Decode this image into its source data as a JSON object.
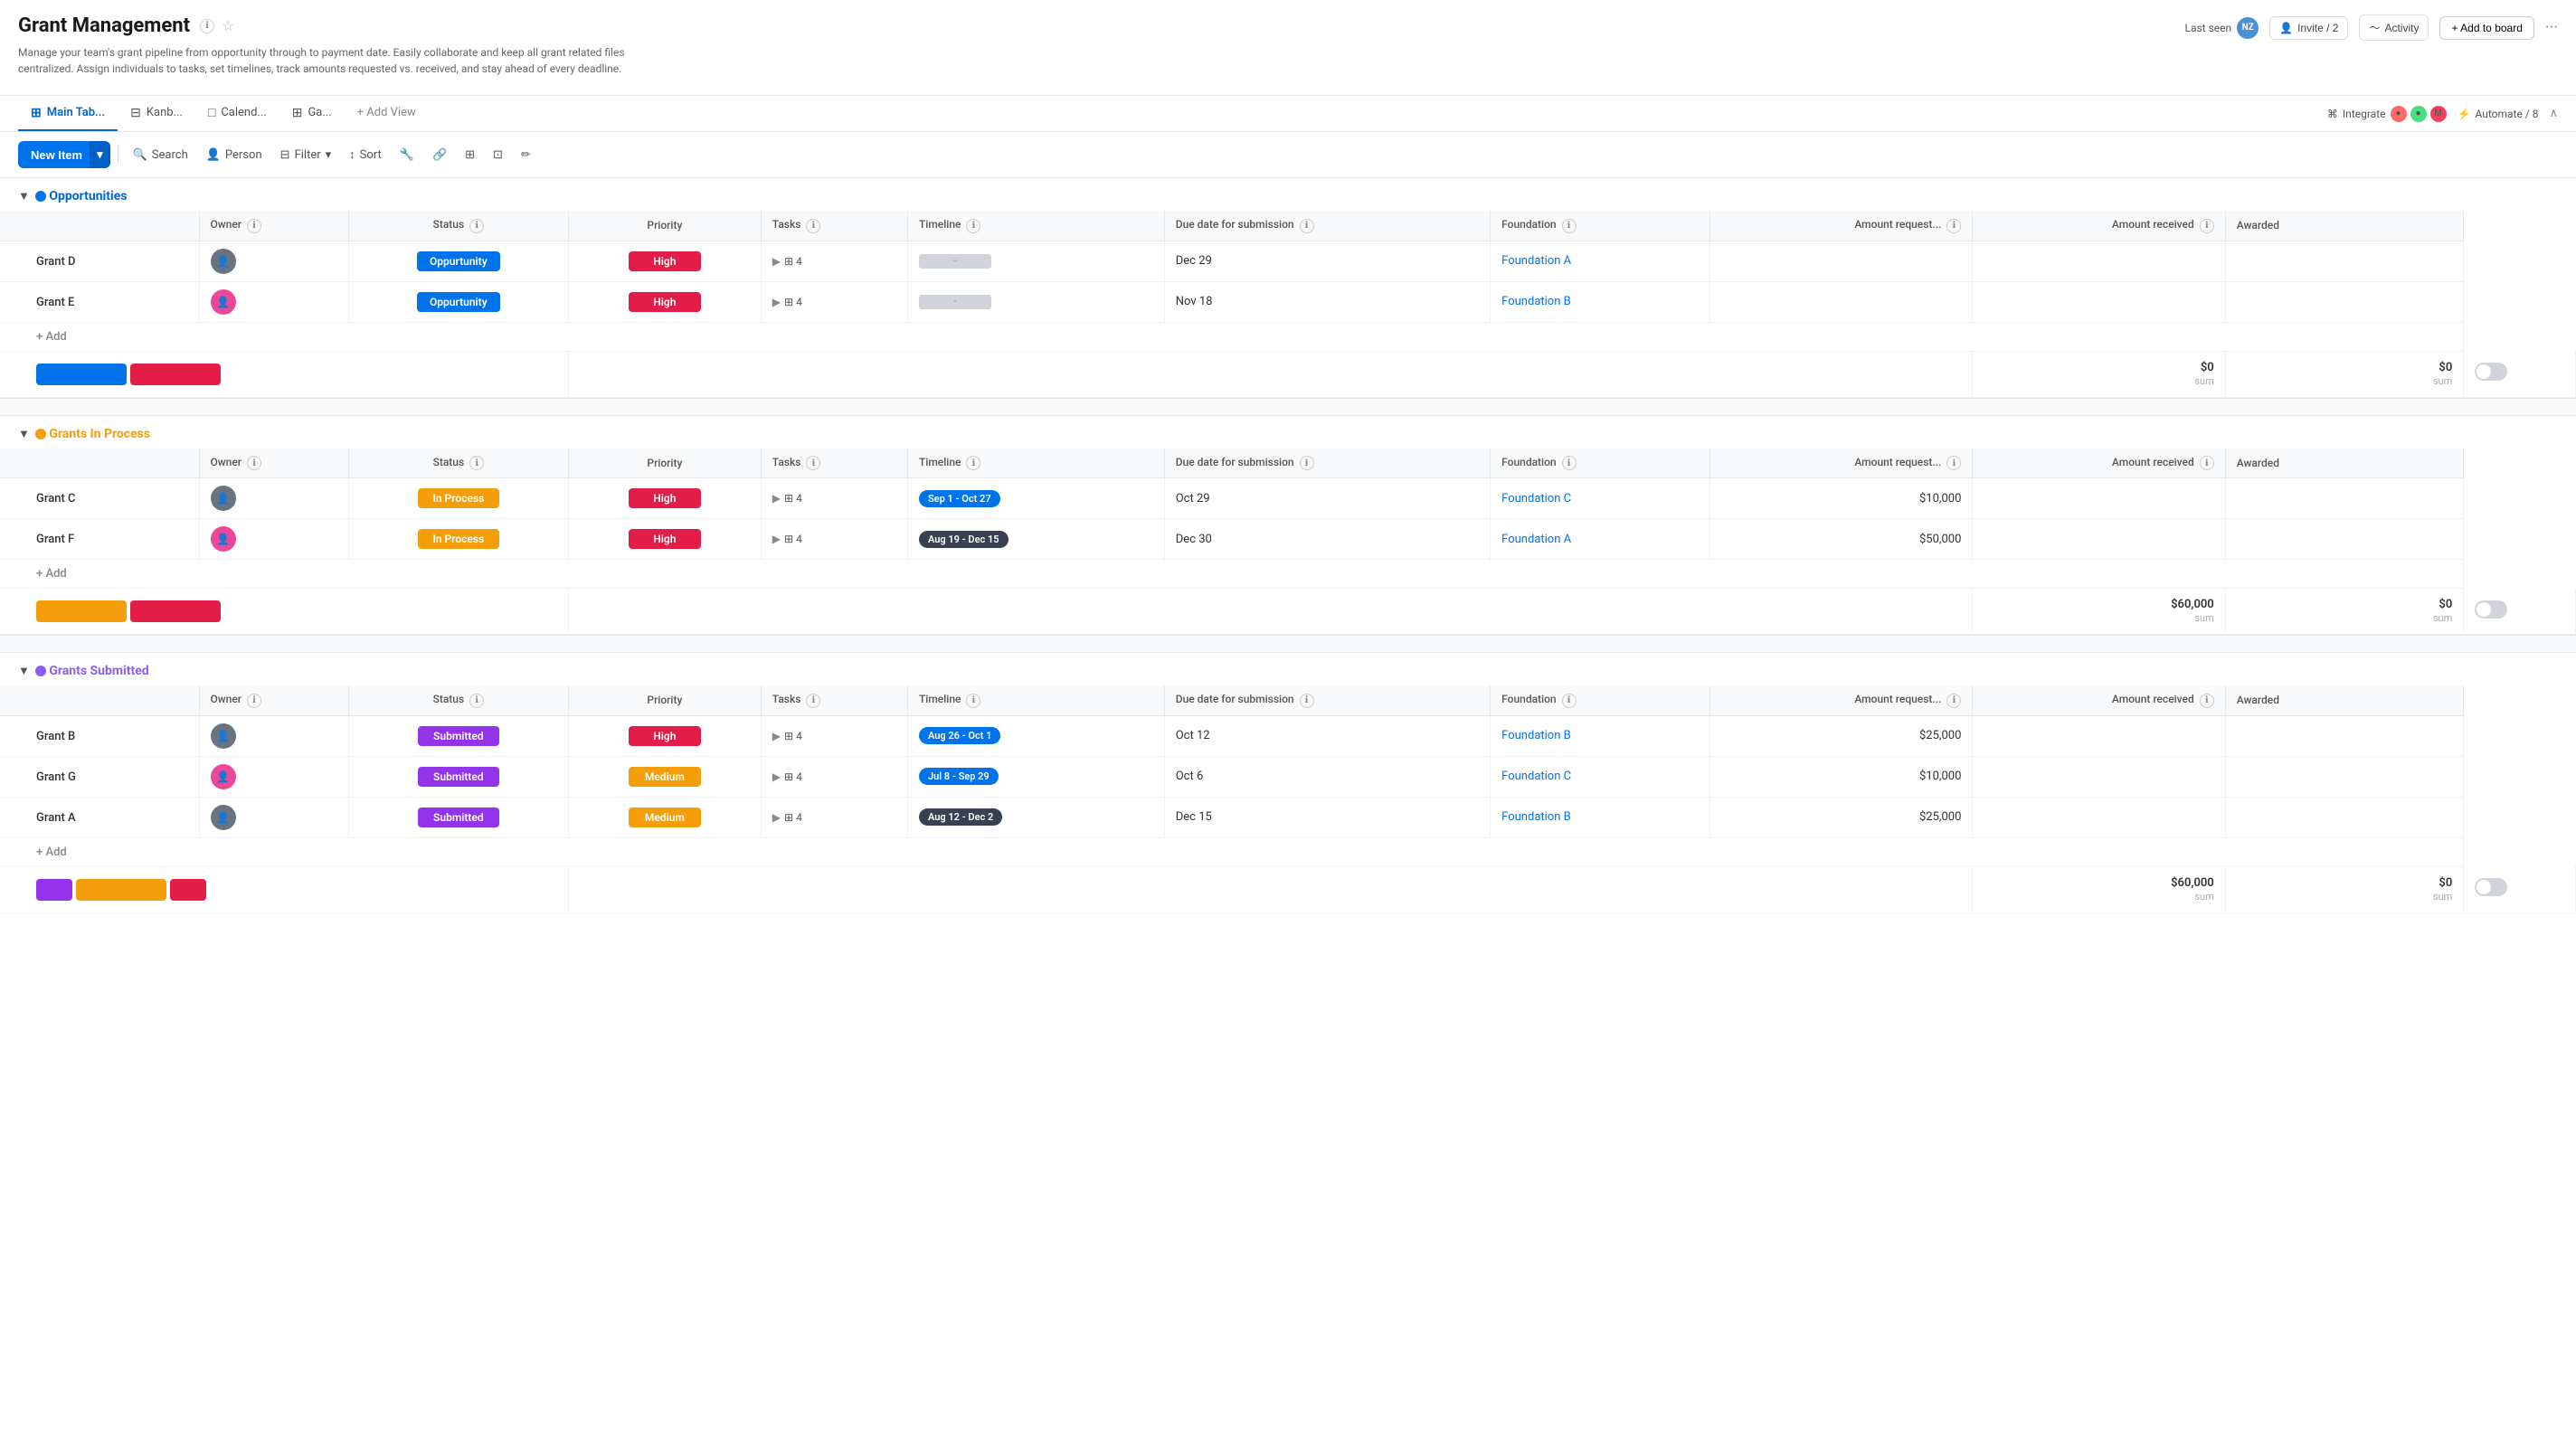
{
  "page": {
    "title": "Grant Management",
    "subtitle": "Manage your team's grant pipeline from opportunity through to payment date. Easily collaborate and keep all grant related files centralized. Assign individuals to tasks, set timelines, track amounts requested vs. received, and stay ahead of every deadline."
  },
  "header": {
    "last_seen_label": "Last seen",
    "invite_label": "Invite / 2",
    "activity_label": "Activity",
    "add_board_label": "+ Add to board",
    "avatar_initials": "NZ"
  },
  "tabs": [
    {
      "id": "main",
      "label": "Main Tab...",
      "icon": "⊞",
      "active": true
    },
    {
      "id": "kanban",
      "label": "Kanb...",
      "icon": "⊟",
      "active": false
    },
    {
      "id": "calendar",
      "label": "Calend...",
      "icon": "□",
      "active": false
    },
    {
      "id": "gantt",
      "label": "Ga...",
      "icon": "⊞",
      "active": false
    },
    {
      "id": "add",
      "label": "+ Add View",
      "icon": "",
      "active": false
    }
  ],
  "toolbar": {
    "new_item_label": "New Item",
    "search_label": "Search",
    "person_label": "Person",
    "filter_label": "Filter",
    "sort_label": "Sort",
    "integrate_label": "Integrate",
    "automate_label": "Automate / 8"
  },
  "sections": [
    {
      "id": "opportunities",
      "title": "Opportunities",
      "color": "blue",
      "columns": [
        "Owner",
        "Status",
        "Priority",
        "Tasks",
        "Timeline",
        "Due date for submission",
        "Foundation",
        "Amount request...",
        "Amount received",
        "Awarded"
      ],
      "rows": [
        {
          "name": "Grant D",
          "owner_gender": "male",
          "status": "Oppurtunity",
          "status_class": "badge-opportunity",
          "priority": "High",
          "priority_class": "priority-high",
          "tasks_count": "4",
          "timeline": "bar",
          "due_date": "Dec 29",
          "foundation": "Foundation A",
          "amount_req": "",
          "amount_rec": "",
          "awarded": ""
        },
        {
          "name": "Grant E",
          "owner_gender": "female",
          "status": "Oppurtunity",
          "status_class": "badge-opportunity",
          "priority": "High",
          "priority_class": "priority-high",
          "tasks_count": "4",
          "timeline": "bar",
          "due_date": "Nov 18",
          "foundation": "Foundation B",
          "amount_req": "",
          "amount_rec": "",
          "awarded": ""
        }
      ],
      "sum_amount_req": "$0",
      "sum_amount_rec": "$0",
      "bar_colors": [
        "blue",
        "red"
      ]
    },
    {
      "id": "grants-in-process",
      "title": "Grants In Process",
      "color": "orange",
      "columns": [
        "Owner",
        "Status",
        "Priority",
        "Tasks",
        "Timeline",
        "Due date for submission",
        "Foundation",
        "Amount request...",
        "Amount received",
        "Awarded"
      ],
      "rows": [
        {
          "name": "Grant C",
          "owner_gender": "male",
          "status": "In Process",
          "status_class": "badge-in-process",
          "priority": "High",
          "priority_class": "priority-high",
          "tasks_count": "4",
          "timeline": "Sep 1 - Oct 27",
          "timeline_class": "timeline-blue",
          "due_date": "Oct 29",
          "foundation": "Foundation C",
          "amount_req": "$10,000",
          "amount_rec": "",
          "awarded": ""
        },
        {
          "name": "Grant F",
          "owner_gender": "female",
          "status": "In Process",
          "status_class": "badge-in-process",
          "priority": "High",
          "priority_class": "priority-high",
          "tasks_count": "4",
          "timeline": "Aug 19 - Dec 15",
          "timeline_class": "timeline-dark",
          "due_date": "Dec 30",
          "foundation": "Foundation A",
          "amount_req": "$50,000",
          "amount_rec": "",
          "awarded": ""
        }
      ],
      "sum_amount_req": "$60,000",
      "sum_amount_rec": "$0",
      "bar_colors": [
        "orange",
        "red"
      ]
    },
    {
      "id": "grants-submitted",
      "title": "Grants Submitted",
      "color": "purple",
      "columns": [
        "Owner",
        "Status",
        "Priority",
        "Tasks",
        "Timeline",
        "Due date for submission",
        "Foundation",
        "Amount request...",
        "Amount received",
        "Awarded"
      ],
      "rows": [
        {
          "name": "Grant B",
          "owner_gender": "male",
          "status": "Submitted",
          "status_class": "badge-submitted",
          "priority": "High",
          "priority_class": "priority-high",
          "tasks_count": "4",
          "timeline": "Aug 26 - Oct 1",
          "timeline_class": "timeline-blue",
          "due_date": "Oct 12",
          "foundation": "Foundation B",
          "amount_req": "$25,000",
          "amount_rec": "",
          "awarded": ""
        },
        {
          "name": "Grant G",
          "owner_gender": "female",
          "status": "Submitted",
          "status_class": "badge-submitted",
          "priority": "Medium",
          "priority_class": "priority-medium",
          "tasks_count": "4",
          "timeline": "Jul 8 - Sep 29",
          "timeline_class": "timeline-blue",
          "due_date": "Oct 6",
          "foundation": "Foundation C",
          "amount_req": "$10,000",
          "amount_rec": "",
          "awarded": ""
        },
        {
          "name": "Grant A",
          "owner_gender": "male",
          "status": "Submitted",
          "status_class": "badge-submitted",
          "priority": "Medium",
          "priority_class": "priority-medium",
          "tasks_count": "4",
          "timeline": "Aug 12 - Dec 2",
          "timeline_class": "timeline-dark",
          "due_date": "Dec 15",
          "foundation": "Foundation B",
          "amount_req": "$25,000",
          "amount_rec": "",
          "awarded": ""
        }
      ],
      "sum_amount_req": "$60,000",
      "sum_amount_rec": "$0",
      "bar_colors": [
        "purple",
        "orange",
        "red"
      ]
    }
  ]
}
